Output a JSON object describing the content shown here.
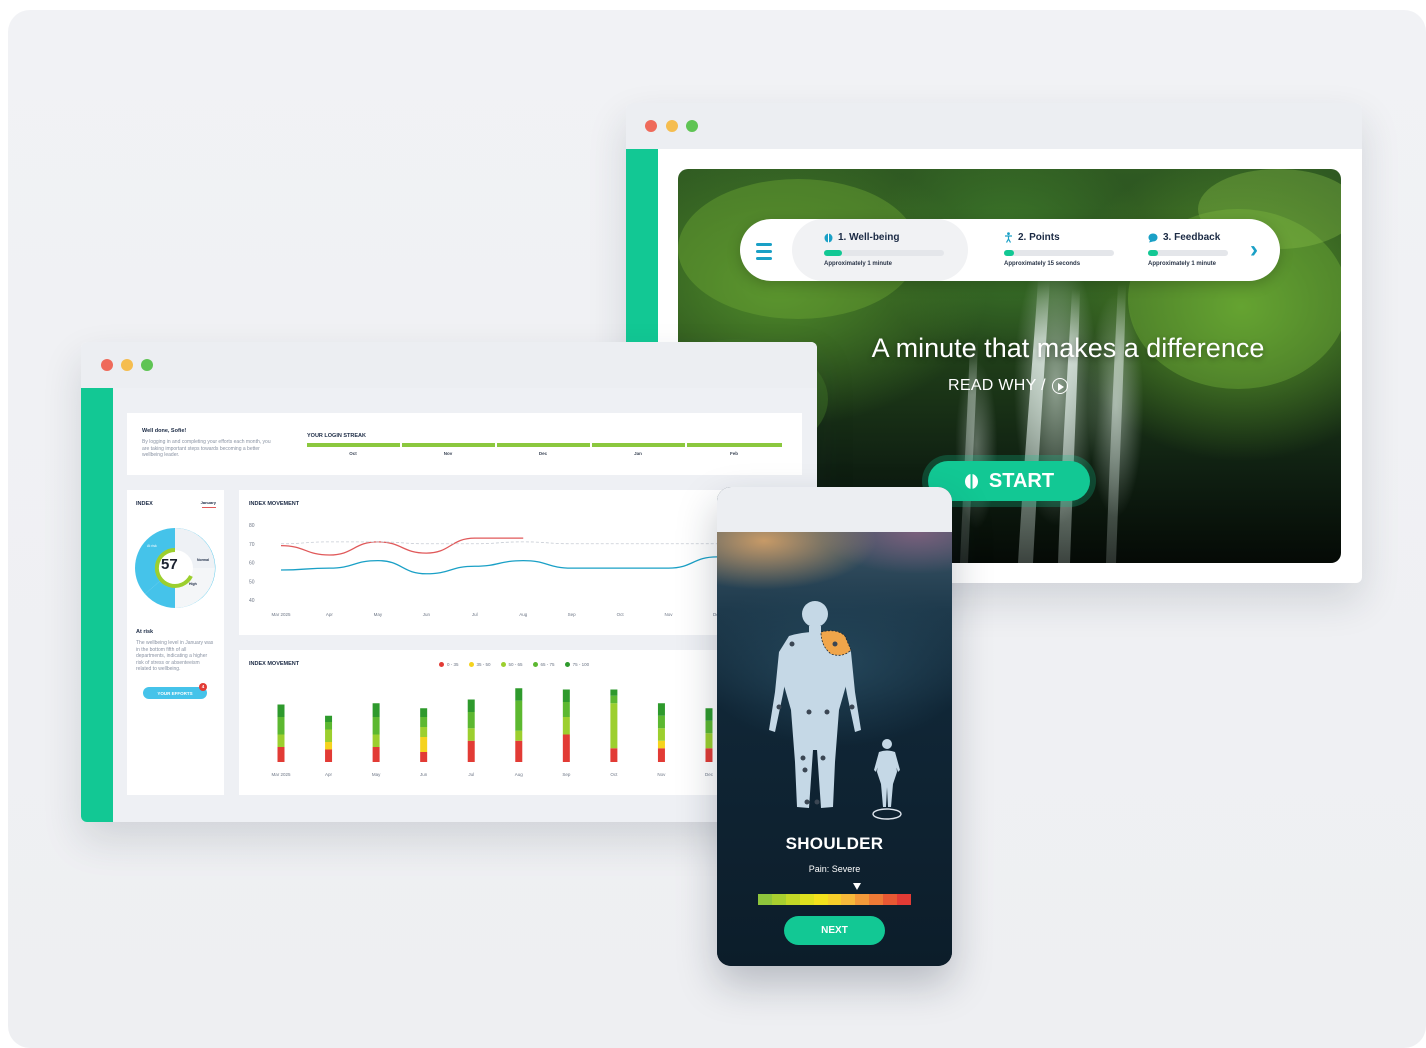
{
  "hero_window": {
    "steps": [
      {
        "label": "1. Well-being",
        "sub": "Approximately 1 minute",
        "icon": "brain-icon"
      },
      {
        "label": "2. Points",
        "sub": "Approximately 15 seconds",
        "icon": "person-icon"
      },
      {
        "label": "3. Feedback",
        "sub": "Approximately 1 minute",
        "icon": "chat-bubble-icon"
      }
    ],
    "title": "A minute that makes a difference",
    "read_why": "READ WHY /",
    "start": "START",
    "colors": {
      "accent": "#12c894",
      "icon_blue": "#1aa0c6"
    }
  },
  "dashboard": {
    "welcome_title": "Well done, Sofie!",
    "welcome_text": "By logging in and completing your efforts each month, you are taking important steps towards becoming a better wellbeing leader.",
    "streak_title": "YOUR LOGIN STREAK",
    "streak_months": [
      "Oct",
      "Nov",
      "Dec",
      "Jan",
      "Feb"
    ],
    "index_title": "INDEX",
    "index_month": "January",
    "index_value": "57",
    "index_labels": {
      "at_risk": "At risk",
      "normal": "Normal",
      "high": "High"
    },
    "at_risk_title": "At risk",
    "at_risk_text": "The wellbeing level in January was in the bottom fifth of all departments, indicating a higher risk of stress or absenteeism related to wellbeing.",
    "efforts_button": "YOUR EFFORTS",
    "efforts_badge": "4",
    "movement_title": "INDEX MOVEMENT",
    "movement_title_2": "INDEX MOVEMENT",
    "legend": [
      "0 - 35",
      "35 - 50",
      "50 - 65",
      "65 - 75",
      "75 - 100"
    ],
    "legend_colors": [
      "#e23b35",
      "#f5d31d",
      "#9ccf2e",
      "#5cb830",
      "#2e9a2c"
    ]
  },
  "chart_data": [
    {
      "type": "line",
      "title": "INDEX MOVEMENT",
      "categories": [
        "Mar 2025",
        "Apr",
        "May",
        "Jun",
        "Jul",
        "Aug",
        "Sep",
        "Oct",
        "Nov",
        "Dec"
      ],
      "y_ticks": [
        80,
        70,
        60,
        50,
        40
      ],
      "ylim": [
        40,
        80
      ],
      "series": [
        {
          "color": "#e0595a",
          "values": [
            69,
            64,
            71,
            65,
            73,
            73,
            null,
            null,
            null,
            null
          ]
        },
        {
          "color": "#1aa0c6",
          "values": [
            56,
            57,
            61,
            54,
            58,
            61,
            57,
            57,
            57,
            63
          ]
        },
        {
          "color": "#c7ccd4",
          "dashed": true,
          "values": [
            70,
            71,
            71,
            70,
            70,
            71,
            70,
            70,
            70,
            70
          ]
        }
      ],
      "grid": false
    },
    {
      "type": "bar",
      "title": "INDEX MOVEMENT",
      "categories": [
        "Mar 2025",
        "Apr",
        "May",
        "Jun",
        "Jul",
        "Aug",
        "Sep",
        "Oct",
        "Nov",
        "Dec"
      ],
      "stacked": true,
      "series": [
        {
          "name": "0 - 35",
          "color": "#e23b35",
          "values": [
            12,
            10,
            12,
            8,
            17,
            17,
            22,
            11,
            11,
            11
          ]
        },
        {
          "name": "35 - 50",
          "color": "#f5d31d",
          "values": [
            0,
            6,
            0,
            12,
            0,
            0,
            0,
            0,
            6,
            0
          ]
        },
        {
          "name": "50 - 65",
          "color": "#9ccf2e",
          "values": [
            10,
            10,
            10,
            8,
            10,
            8,
            14,
            36,
            10,
            12
          ]
        },
        {
          "name": "65 - 75",
          "color": "#5cb830",
          "values": [
            14,
            6,
            14,
            8,
            13,
            24,
            12,
            6,
            10,
            10
          ]
        },
        {
          "name": "75 - 100",
          "color": "#2e9a2c",
          "values": [
            10,
            5,
            11,
            7,
            10,
            10,
            10,
            5,
            10,
            10
          ]
        }
      ]
    }
  ],
  "phone": {
    "body_part": "SHOULDER",
    "pain": "Pain: Severe",
    "pain_level": 0.64,
    "scale_colors": [
      "#8fc53c",
      "#a8cf2f",
      "#c3d827",
      "#dfe11f",
      "#f3e21d",
      "#f7cf2a",
      "#f7b93a",
      "#f39a3a",
      "#ee7a36",
      "#e85833",
      "#e23b35"
    ],
    "next": "NEXT",
    "highlight_color": "#f0a54a"
  }
}
